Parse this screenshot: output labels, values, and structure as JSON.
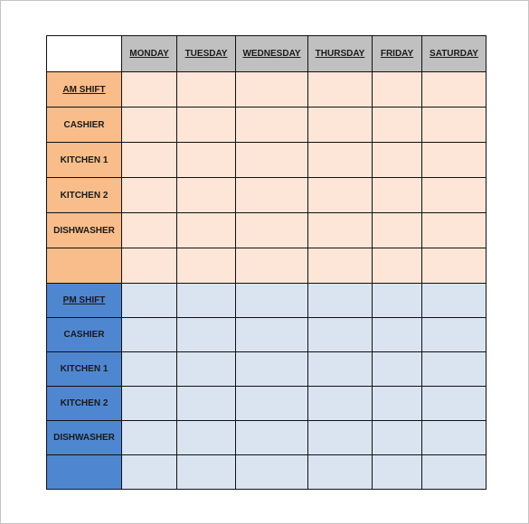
{
  "days": [
    "MONDAY",
    "TUESDAY",
    "WEDNESDAY",
    "THURSDAY",
    "FRIDAY",
    "SATURDAY"
  ],
  "am": {
    "title": "AM SHIFT",
    "roles": [
      "CASHIER",
      "KITCHEN 1",
      "KITCHEN 2",
      "DISHWASHER",
      ""
    ],
    "colors": {
      "label": "#f8bd8a",
      "cell": "#fde6d7"
    }
  },
  "pm": {
    "title": "PM SHIFT",
    "roles": [
      "CASHIER",
      "KITCHEN 1",
      "KITCHEN 2",
      "DISHWASHER",
      ""
    ],
    "colors": {
      "label": "#4f86d0",
      "cell": "#dae4f1"
    }
  },
  "header_color": "#c0c0c0"
}
